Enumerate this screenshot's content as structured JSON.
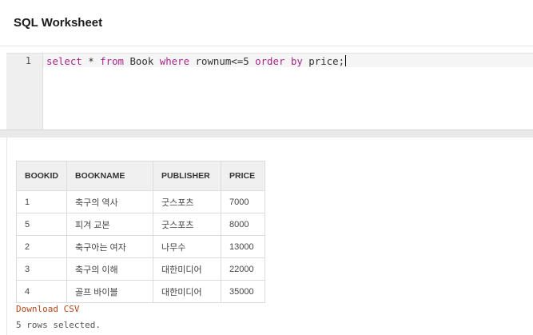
{
  "header": {
    "title": "SQL Worksheet"
  },
  "editor": {
    "line_number": "1",
    "tokens": [
      "select",
      " * ",
      "from",
      " Book ",
      "where",
      " rownum<=5 ",
      "order by",
      " price;"
    ]
  },
  "results": {
    "columns": [
      "BOOKID",
      "BOOKNAME",
      "PUBLISHER",
      "PRICE"
    ],
    "rows": [
      [
        "1",
        "축구의 역사",
        "굿스포츠",
        "7000"
      ],
      [
        "5",
        "피겨 교본",
        "굿스포츠",
        "8000"
      ],
      [
        "2",
        "축구아는 여자",
        "나무수",
        "13000"
      ],
      [
        "3",
        "축구의 이해",
        "대한미디어",
        "22000"
      ],
      [
        "4",
        "골프 바이블",
        "대한미디어",
        "35000"
      ]
    ],
    "download_label": "Download CSV",
    "status": "5 rows selected."
  },
  "colors": {
    "keyword": "#a6278b",
    "download_link": "#b04a1a"
  }
}
